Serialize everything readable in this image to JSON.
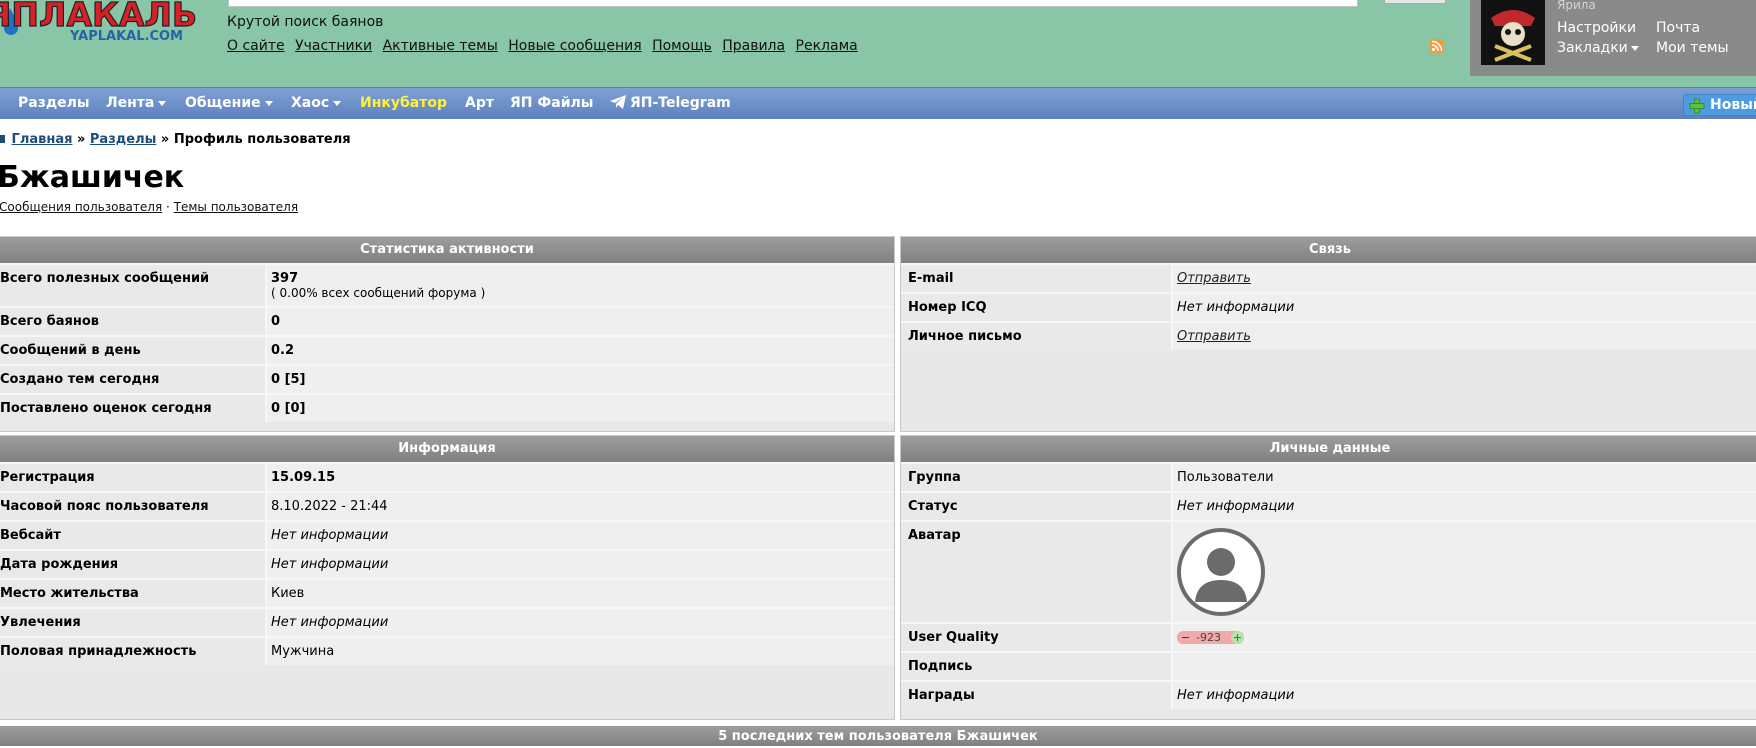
{
  "header": {
    "logo_text": "ЯПЛАКАЛЬ",
    "logo_sub": "YAPLAKAL.COM",
    "tagline": "Крутой поиск баянов",
    "links": [
      "О сайте",
      "Участники",
      "Активные темы",
      "Новые сообщения",
      "Помощь",
      "Правила",
      "Реклама"
    ]
  },
  "user_box": {
    "username": "Ярила",
    "settings": "Настройки",
    "mail": "Почта",
    "bookmarks": "Закладки",
    "my_topics": "Мои темы"
  },
  "nav": {
    "items": [
      "Разделы",
      "Лента",
      "Общение",
      "Хаос",
      "Инкубатор",
      "Арт",
      "ЯП Файлы",
      "ЯП-Telegram"
    ],
    "new_button": "Новый"
  },
  "colors": {
    "header_bg": "#88c6a7",
    "nav_bg": "#6a8ec8",
    "nav_highlight": "#fff23a",
    "panel_head": "#8e8e8e"
  },
  "breadcrumb": {
    "home": "Главная",
    "sections": "Разделы",
    "current": "Профиль пользователя",
    "separator": "»"
  },
  "profile": {
    "name": "Бжашичек",
    "messages_link": "Сообщения пользователя",
    "topics_link": "Темы пользователя",
    "separator": "·"
  },
  "activity": {
    "title": "Статистика активности",
    "rows": [
      {
        "label": "Всего полезных сообщений",
        "value": "397",
        "sub": "( 0.00% всех сообщений форума )"
      },
      {
        "label": "Всего баянов",
        "value": "0"
      },
      {
        "label": "Сообщений в день",
        "value": "0.2"
      },
      {
        "label": "Создано тем сегодня",
        "value": "0 [5]"
      },
      {
        "label": "Поставлено оценок сегодня",
        "value": "0 [0]"
      }
    ]
  },
  "contact": {
    "title": "Связь",
    "rows": [
      {
        "label": "E-mail",
        "value": "Отправить"
      },
      {
        "label": "Номер ICQ",
        "value": "Нет информации"
      },
      {
        "label": "Личное письмо",
        "value": "Отправить"
      }
    ]
  },
  "info": {
    "title": "Информация",
    "rows": [
      {
        "label": "Регистрация",
        "value": "15.09.15"
      },
      {
        "label": "Часовой пояс пользователя",
        "value": "8.10.2022 - 21:44"
      },
      {
        "label": "Вебсайт",
        "value": "Нет информации"
      },
      {
        "label": "Дата рождения",
        "value": "Нет информации"
      },
      {
        "label": "Место жительства",
        "value": "Киев"
      },
      {
        "label": "Увлечения",
        "value": "Нет информации"
      },
      {
        "label": "Половая принадлежность",
        "value": "Мужчина"
      }
    ]
  },
  "personal": {
    "title": "Личные данные",
    "rows": [
      {
        "label": "Группа",
        "value": "Пользователи"
      },
      {
        "label": "Статус",
        "value": "Нет информации"
      },
      {
        "label": "Аватар",
        "value": ""
      },
      {
        "label": "User Quality",
        "value": "-923",
        "minus": "−",
        "plus": "+"
      },
      {
        "label": "Подпись",
        "value": ""
      },
      {
        "label": "Награды",
        "value": "Нет информации"
      }
    ]
  },
  "footer": {
    "last_topics": "5 последних тем пользователя Бжашичек"
  }
}
